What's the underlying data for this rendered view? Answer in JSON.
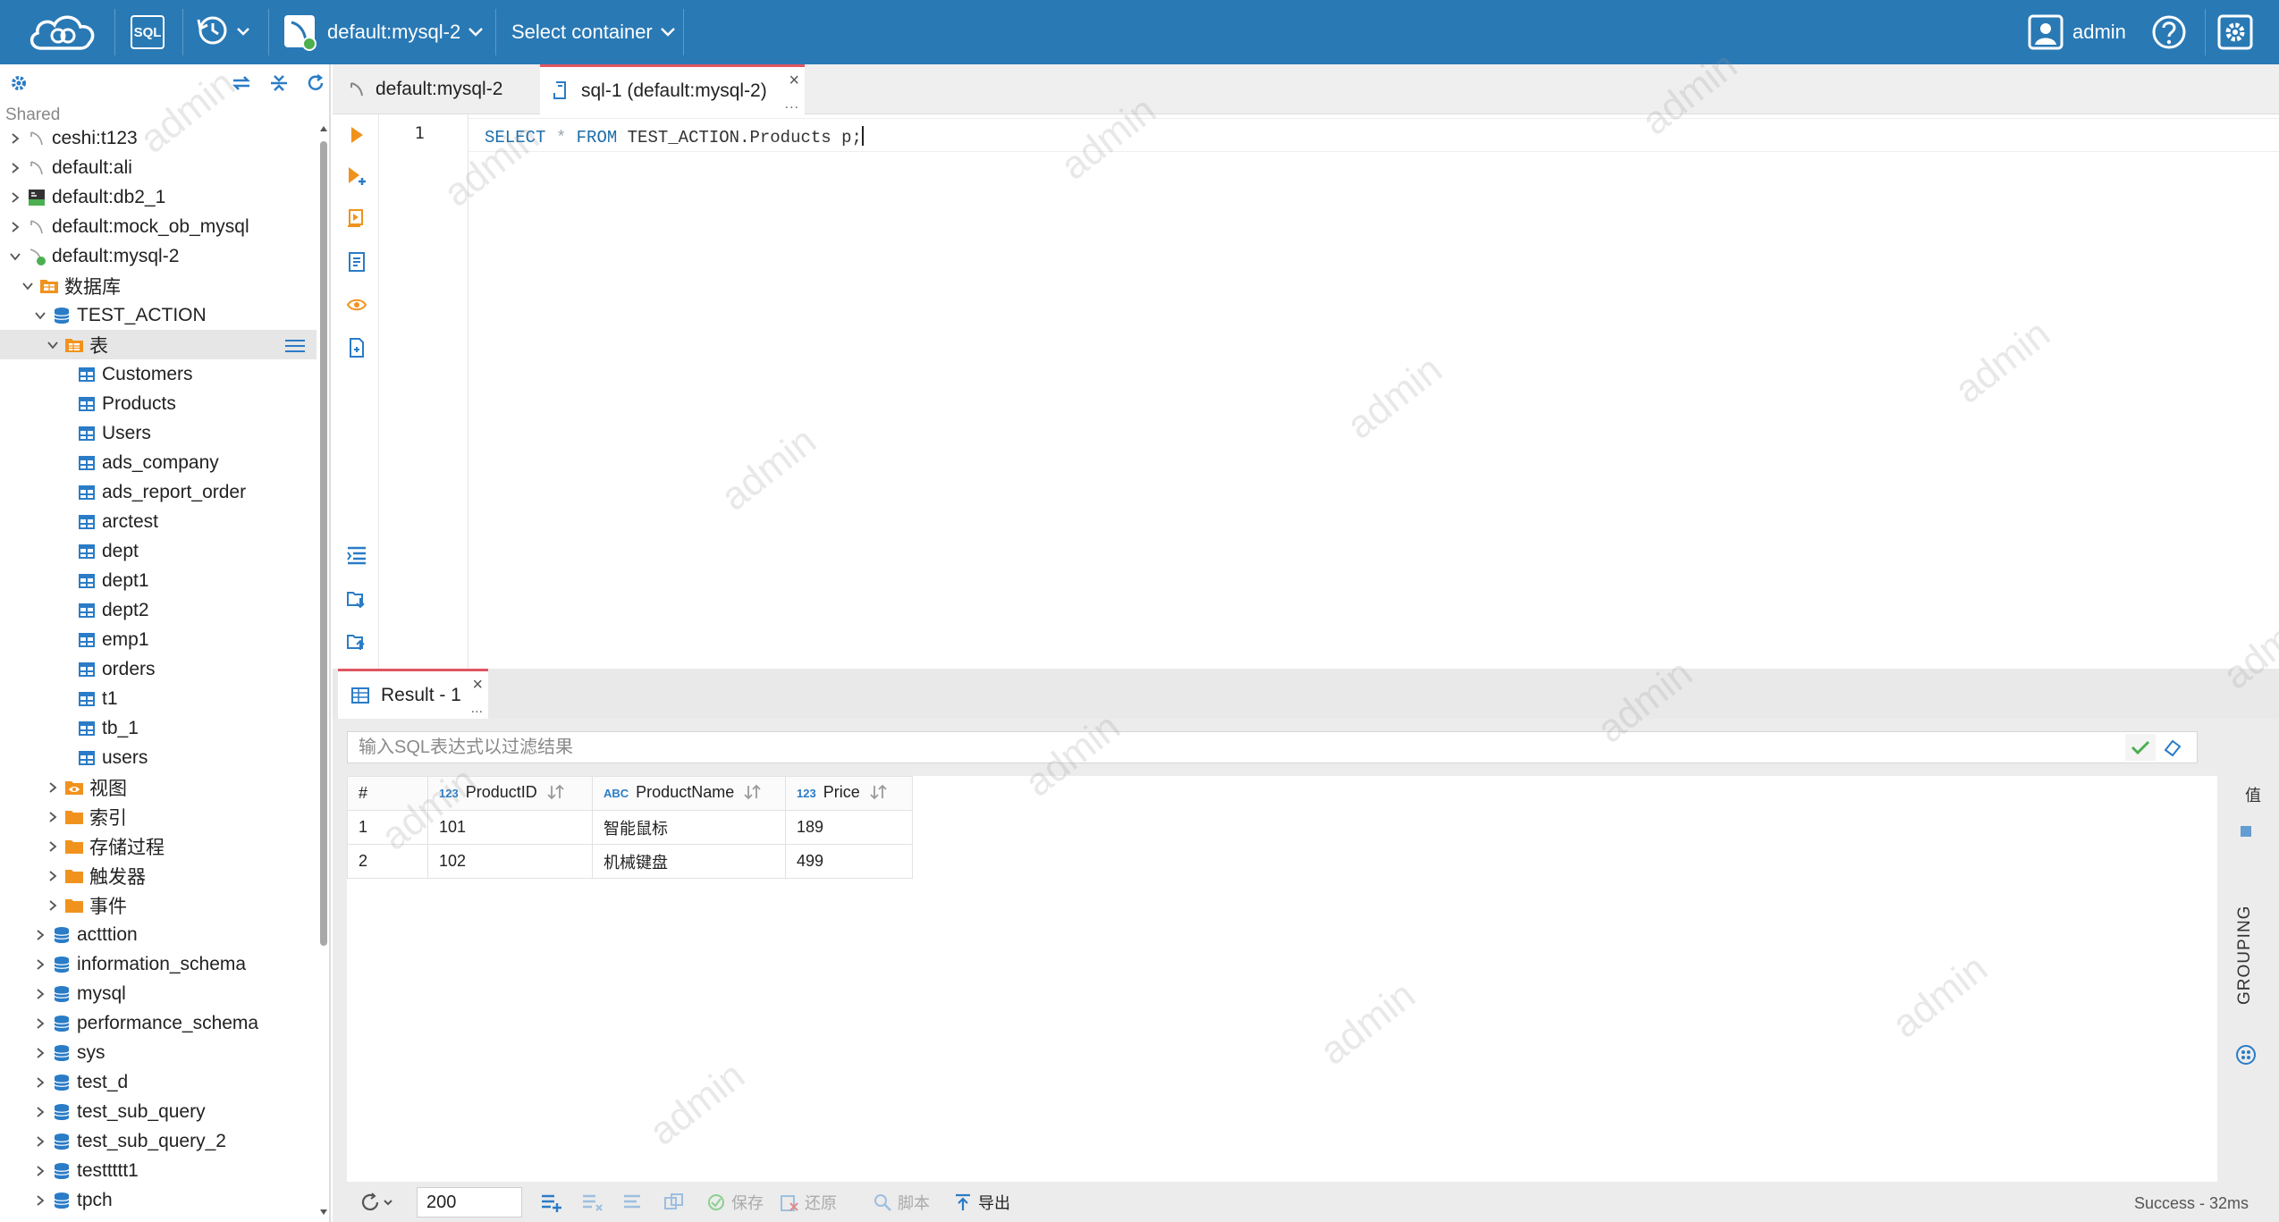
{
  "topbar": {
    "sql_label": "SQL",
    "connection_label": "default:mysql-2",
    "container_label": "Select container",
    "user_name": "admin"
  },
  "sidebar": {
    "shared_label": "Shared",
    "tree": [
      {
        "label": "ceshi:t123",
        "icon": "connection-icon",
        "level": 0,
        "expand": "collapsed"
      },
      {
        "label": "default:ali",
        "icon": "connection-icon",
        "level": 0,
        "expand": "collapsed"
      },
      {
        "label": "default:db2_1",
        "icon": "db2-icon",
        "level": 0,
        "expand": "collapsed"
      },
      {
        "label": "default:mock_ob_mysql",
        "icon": "connection-icon",
        "level": 0,
        "expand": "collapsed"
      },
      {
        "label": "default:mysql-2",
        "icon": "connection-active-icon",
        "level": 0,
        "expand": "expanded"
      },
      {
        "label": "数据库",
        "icon": "database-folder-icon",
        "level": 1,
        "expand": "expanded"
      },
      {
        "label": "TEST_ACTION",
        "icon": "database-icon",
        "level": 2,
        "expand": "expanded"
      },
      {
        "label": "表",
        "icon": "tables-folder-icon",
        "level": 3,
        "expand": "expanded",
        "selected": true
      },
      {
        "label": "Customers",
        "icon": "table-icon",
        "level": 4,
        "expand": "none"
      },
      {
        "label": "Products",
        "icon": "table-icon",
        "level": 4,
        "expand": "none"
      },
      {
        "label": "Users",
        "icon": "table-icon",
        "level": 4,
        "expand": "none"
      },
      {
        "label": "ads_company",
        "icon": "table-icon",
        "level": 4,
        "expand": "none"
      },
      {
        "label": "ads_report_order",
        "icon": "table-icon",
        "level": 4,
        "expand": "none"
      },
      {
        "label": "arctest",
        "icon": "table-icon",
        "level": 4,
        "expand": "none"
      },
      {
        "label": "dept",
        "icon": "table-icon",
        "level": 4,
        "expand": "none"
      },
      {
        "label": "dept1",
        "icon": "table-icon",
        "level": 4,
        "expand": "none"
      },
      {
        "label": "dept2",
        "icon": "table-icon",
        "level": 4,
        "expand": "none"
      },
      {
        "label": "emp1",
        "icon": "table-icon",
        "level": 4,
        "expand": "none"
      },
      {
        "label": "orders",
        "icon": "table-icon",
        "level": 4,
        "expand": "none"
      },
      {
        "label": "t1",
        "icon": "table-icon",
        "level": 4,
        "expand": "none"
      },
      {
        "label": "tb_1",
        "icon": "table-icon",
        "level": 4,
        "expand": "none"
      },
      {
        "label": "users",
        "icon": "table-icon",
        "level": 4,
        "expand": "none"
      },
      {
        "label": "视图",
        "icon": "views-folder-icon",
        "level": 3,
        "expand": "collapsed"
      },
      {
        "label": "索引",
        "icon": "folder-icon",
        "level": 3,
        "expand": "collapsed"
      },
      {
        "label": "存储过程",
        "icon": "folder-icon",
        "level": 3,
        "expand": "collapsed"
      },
      {
        "label": "触发器",
        "icon": "folder-icon",
        "level": 3,
        "expand": "collapsed"
      },
      {
        "label": "事件",
        "icon": "folder-icon",
        "level": 3,
        "expand": "collapsed"
      },
      {
        "label": "actttion",
        "icon": "database-icon",
        "level": 2,
        "expand": "collapsed"
      },
      {
        "label": "information_schema",
        "icon": "database-icon",
        "level": 2,
        "expand": "collapsed"
      },
      {
        "label": "mysql",
        "icon": "database-icon",
        "level": 2,
        "expand": "collapsed"
      },
      {
        "label": "performance_schema",
        "icon": "database-icon",
        "level": 2,
        "expand": "collapsed"
      },
      {
        "label": "sys",
        "icon": "database-icon",
        "level": 2,
        "expand": "collapsed"
      },
      {
        "label": "test_d",
        "icon": "database-icon",
        "level": 2,
        "expand": "collapsed"
      },
      {
        "label": "test_sub_query",
        "icon": "database-icon",
        "level": 2,
        "expand": "collapsed"
      },
      {
        "label": "test_sub_query_2",
        "icon": "database-icon",
        "level": 2,
        "expand": "collapsed"
      },
      {
        "label": "testtttt1",
        "icon": "database-icon",
        "level": 2,
        "expand": "collapsed"
      },
      {
        "label": "tpch",
        "icon": "database-icon",
        "level": 2,
        "expand": "collapsed"
      }
    ]
  },
  "editor_tabs": [
    {
      "label": "default:mysql-2",
      "icon": "connection-icon",
      "active": false
    },
    {
      "label": "sql-1 (default:mysql-2)",
      "icon": "sql-file-icon",
      "active": true
    }
  ],
  "editor": {
    "line_number": "1",
    "code": {
      "kw_select": "SELECT",
      "star": "*",
      "kw_from": "FROM",
      "rest": "TEST_ACTION.Products p;"
    }
  },
  "result_tab": {
    "label": "Result - 1"
  },
  "results": {
    "filter_placeholder": "输入SQL表达式以过滤结果",
    "columns": [
      {
        "label": "#",
        "type": ""
      },
      {
        "label": "ProductID",
        "type": "123"
      },
      {
        "label": "ProductName",
        "type": "ABC"
      },
      {
        "label": "Price",
        "type": "123"
      }
    ],
    "rows": [
      [
        "1",
        "101",
        "智能鼠标",
        "189"
      ],
      [
        "2",
        "102",
        "机械键盘",
        "499"
      ]
    ],
    "grouping_label": "GROUPING",
    "side_label": "值",
    "limit_value": "200",
    "actions": {
      "save": "保存",
      "revert": "还原",
      "script": "脚本",
      "export": "导出"
    },
    "status": "Success - 32ms"
  },
  "watermark_text": "admin",
  "colors": {
    "topbar": "#2979b5",
    "tab_accent": "#e05561",
    "keyword": "#1d6ea8",
    "run_orange": "#f0931e"
  }
}
